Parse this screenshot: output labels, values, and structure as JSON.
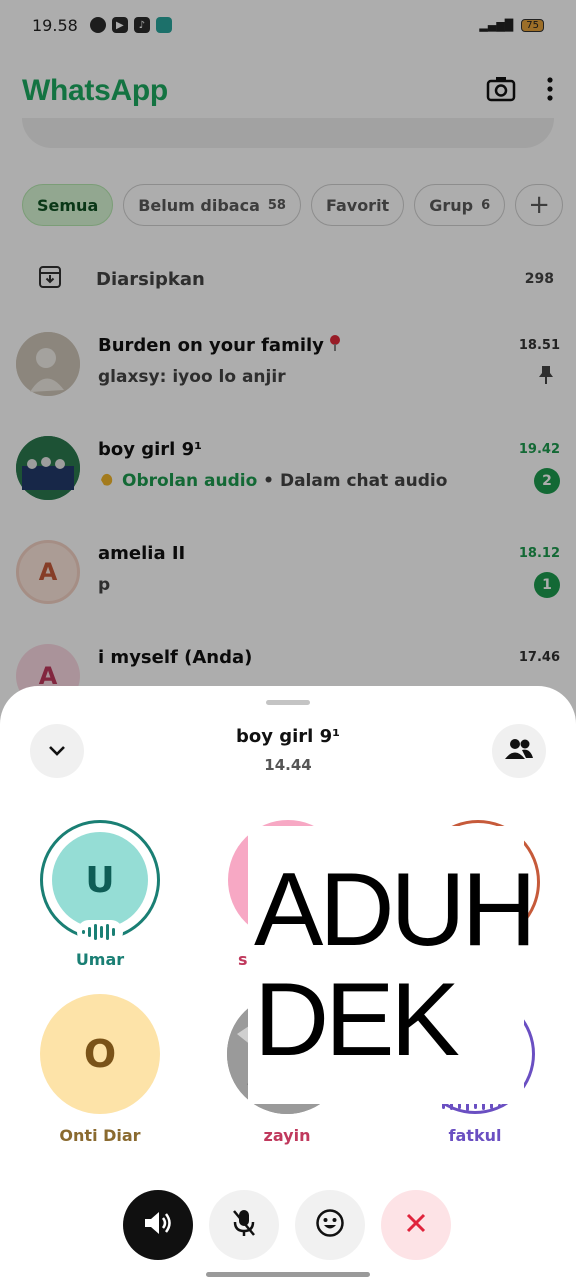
{
  "status_bar": {
    "time": "19.58",
    "battery": "75"
  },
  "app": {
    "title": "WhatsApp"
  },
  "filters": [
    {
      "label": "Semua",
      "count": ""
    },
    {
      "label": "Belum dibaca",
      "count": "58"
    },
    {
      "label": "Favorit",
      "count": ""
    },
    {
      "label": "Grup",
      "count": "6"
    }
  ],
  "filter_add": "+",
  "archived": {
    "label": "Diarsipkan",
    "count": "298"
  },
  "chats": [
    {
      "name": "Burden on your family",
      "time": "18.51",
      "preview": "glaxsy: iyoo lo anjir"
    },
    {
      "name": "boy girl 9¹",
      "time": "19.42",
      "preview_status": "Obrolan audio",
      "preview_rest": " • Dalam chat audio",
      "unread": "2"
    },
    {
      "name": "amelia II",
      "time": "18.12",
      "preview": "p",
      "unread": "1",
      "avatar_letter": "A"
    },
    {
      "name": "i myself (Anda)",
      "time": "17.46",
      "avatar_letter": "A"
    }
  ],
  "call_sheet": {
    "title": "boy girl 9¹",
    "duration": "14.44",
    "participants": [
      {
        "initial": "U",
        "name": "Umar"
      },
      {
        "initial": "O",
        "name": "Onti Diar"
      },
      {
        "initial": "",
        "name": "zayin"
      },
      {
        "initial": "",
        "name": "fatkul"
      }
    ],
    "partial_name": "s",
    "overlay_lines": [
      "ADUH",
      "DEK"
    ]
  },
  "colors": {
    "brand_green": "#1daa61",
    "unread_green": "#1c9b4e",
    "speaking_teal": "#1a7f74",
    "end_call_red": "#e0243c"
  }
}
